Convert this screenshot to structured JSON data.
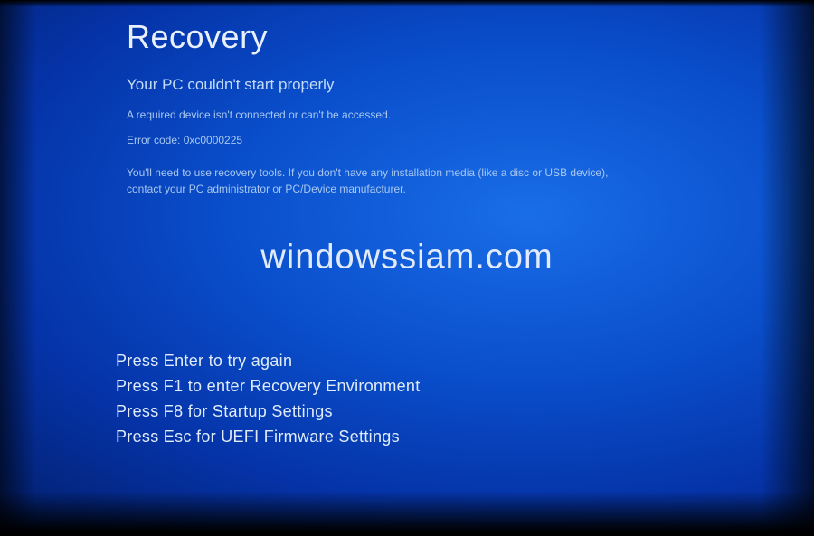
{
  "header": {
    "title": "Recovery",
    "subtitle": "Your PC couldn't start properly"
  },
  "error": {
    "message": "A required device isn't connected or can't be accessed.",
    "code_label": "Error code: 0xc0000225",
    "instructions": "You'll need to use recovery tools. If you don't have any installation media (like a disc or USB device), contact your PC administrator or PC/Device manufacturer."
  },
  "watermark": "windowssiam.com",
  "options": [
    "Press Enter to try again",
    "Press F1 to enter Recovery Environment",
    "Press F8 for Startup Settings",
    "Press Esc for UEFI Firmware Settings"
  ]
}
